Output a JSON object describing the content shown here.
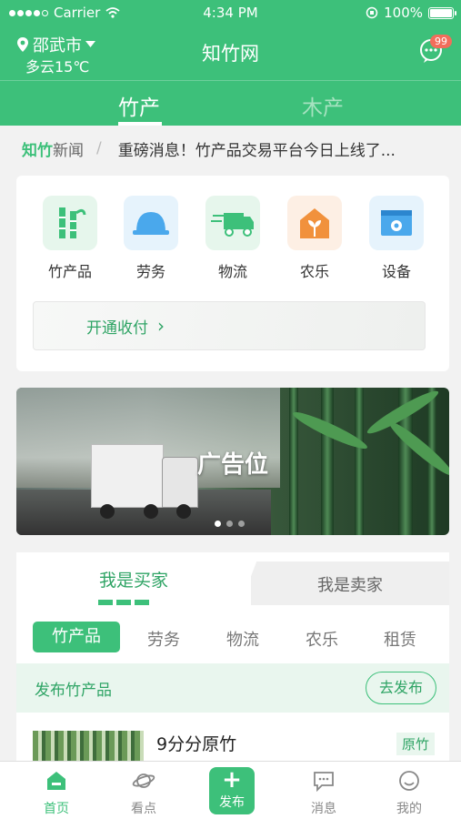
{
  "status_bar": {
    "carrier": "Carrier",
    "time": "4:34 PM",
    "battery": "100%"
  },
  "header": {
    "city": "邵武市",
    "weather": "多云15℃",
    "title": "知竹网",
    "message_badge": "99",
    "tabs": [
      {
        "label": "竹产",
        "active": true
      },
      {
        "label": "木产",
        "active": false
      }
    ]
  },
  "news": {
    "brand_a": "知竹",
    "brand_b": "新闻",
    "separator": "/",
    "headline": "重磅消息！竹产品交易平台今日上线了..."
  },
  "categories": [
    {
      "label": "竹产品",
      "icon": "bamboo-icon"
    },
    {
      "label": "劳务",
      "icon": "helmet-icon"
    },
    {
      "label": "物流",
      "icon": "truck-icon"
    },
    {
      "label": "农乐",
      "icon": "farm-house-icon"
    },
    {
      "label": "设备",
      "icon": "equipment-icon"
    }
  ],
  "payment": {
    "label": "开通收付",
    "arrow": "›"
  },
  "banner": {
    "label": "广告位",
    "pages": 3,
    "current_page": 1
  },
  "role_tabs": [
    {
      "label": "我是买家",
      "active": true
    },
    {
      "label": "我是卖家",
      "active": false
    }
  ],
  "sub_tabs": [
    {
      "label": "竹产品",
      "active": true
    },
    {
      "label": "劳务",
      "active": false
    },
    {
      "label": "物流",
      "active": false
    },
    {
      "label": "农乐",
      "active": false
    },
    {
      "label": "租赁",
      "active": false
    }
  ],
  "publish_bar": {
    "label": "发布竹产品",
    "button": "去发布"
  },
  "listing": {
    "title": "9分分原竹",
    "tag": "原竹"
  },
  "bottom_nav": [
    {
      "label": "首页",
      "icon": "home-icon",
      "active": true
    },
    {
      "label": "看点",
      "icon": "planet-icon",
      "active": false
    },
    {
      "label": "发布",
      "icon": "plus-icon",
      "active": false
    },
    {
      "label": "消息",
      "icon": "chat-icon",
      "active": false
    },
    {
      "label": "我的",
      "icon": "smile-icon",
      "active": false
    }
  ],
  "colors": {
    "brand": "#3dc07a",
    "brand_dark": "#2fa465",
    "badge": "#f26d5b",
    "page_bg": "#f2f2f2"
  }
}
